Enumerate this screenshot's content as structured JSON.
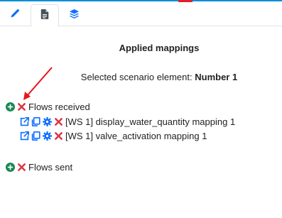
{
  "tabs": [
    {
      "icon": "pencil-icon"
    },
    {
      "icon": "document-icon"
    },
    {
      "icon": "layers-icon"
    }
  ],
  "panel": {
    "title": "Applied mappings",
    "selected_prefix": "Selected scenario element: ",
    "selected_value": "Number 1"
  },
  "flows_received": {
    "label": "Flows received",
    "mappings": [
      {
        "label": "[WS 1] display_water_quantity mapping 1"
      },
      {
        "label": "[WS 1] valve_activation mapping 1"
      }
    ]
  },
  "flows_sent": {
    "label": "Flows sent"
  },
  "colors": {
    "accent_blue": "#0d6efd",
    "add_green": "#198754",
    "remove_red": "#dc3545",
    "annotation_arrow": "#e8141c"
  }
}
